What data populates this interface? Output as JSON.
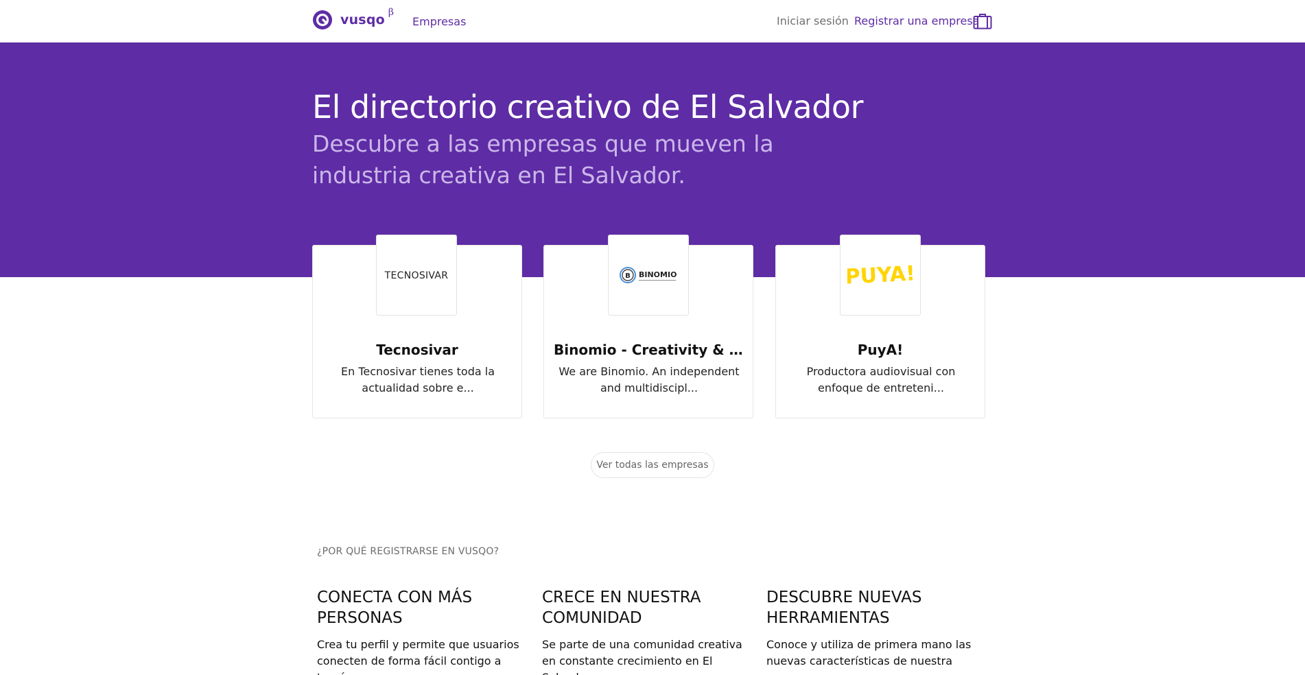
{
  "nav": {
    "brand": "vusqo",
    "beta": "β",
    "empresas": "Empresas",
    "login": "Iniciar sesión",
    "register": "Registrar una empresa"
  },
  "hero": {
    "title": "El directorio creativo de El Salvador",
    "subtitle": "Descubre a las empresas que mueven la industria creativa en El Salvador."
  },
  "companies": [
    {
      "name": "Tecnosivar",
      "description": "En Tecnosivar tienes toda la actualidad sobre e...",
      "logo_text": "TECNOSIVAR"
    },
    {
      "name": "Binomio - Creativity & Ap...",
      "description": "We are Binomio. An independent and multidiscipl...",
      "logo_text": "BINOMIO"
    },
    {
      "name": "PuyA!",
      "description": "Productora audiovisual con enfoque de entreteni...",
      "logo_text": "PUYA!"
    }
  ],
  "see_all": "Ver todas las empresas",
  "why": {
    "kicker": "¿POR QUÉ REGISTRARSE EN VUSQO?",
    "features": [
      {
        "title": "CONECTA CON MÁS PERSONAS",
        "description": "Crea tu perfil y permite que usuarios conecten de forma fácil contigo a través"
      },
      {
        "title": "CRECE EN NUESTRA COMUNIDAD",
        "description": "Se parte de una comunidad creativa en constante crecimiento en El Salvador."
      },
      {
        "title": "DESCUBRE NUEVAS HERRAMIENTAS",
        "description": "Conoce y utiliza de primera mano las nuevas características de nuestra"
      }
    ]
  },
  "colors": {
    "brand_purple": "#5e2ca5",
    "hero_subtitle": "#cbb7ea",
    "puya_yellow": "#ffd400"
  }
}
